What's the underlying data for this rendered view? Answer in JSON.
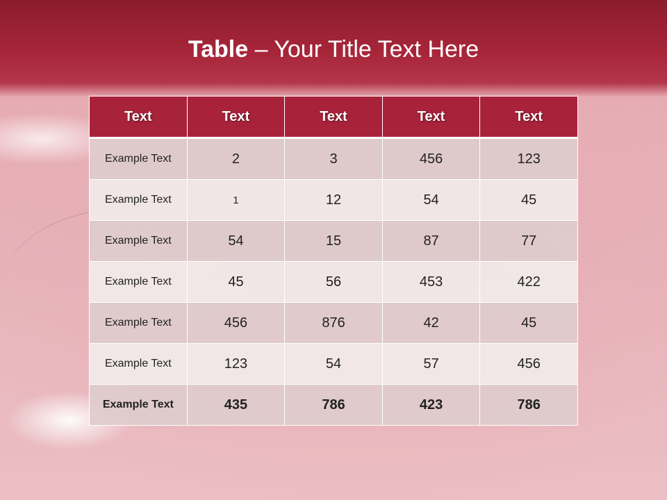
{
  "slide": {
    "title_bold": "Table",
    "title_rest": " – Your Title Text Here"
  },
  "table": {
    "headers": [
      "Text",
      "Text",
      "Text",
      "Text",
      "Text"
    ],
    "rows": [
      [
        "Example Text",
        "2",
        "3",
        "456",
        "123"
      ],
      [
        "Example Text",
        "1",
        "12",
        "54",
        "45"
      ],
      [
        "Example Text",
        "54",
        "15",
        "87",
        "77"
      ],
      [
        "Example Text",
        "45",
        "56",
        "453",
        "422"
      ],
      [
        "Example Text",
        "456",
        "876",
        "42",
        "45"
      ],
      [
        "Example Text",
        "123",
        "54",
        "57",
        "456"
      ],
      [
        "Example Text",
        "435",
        "786",
        "423",
        "786"
      ]
    ]
  },
  "colors": {
    "banner": "#a8233a",
    "header_bg": "#a8233a",
    "row_odd": "#ddcacc",
    "row_even": "#f1eaea"
  }
}
